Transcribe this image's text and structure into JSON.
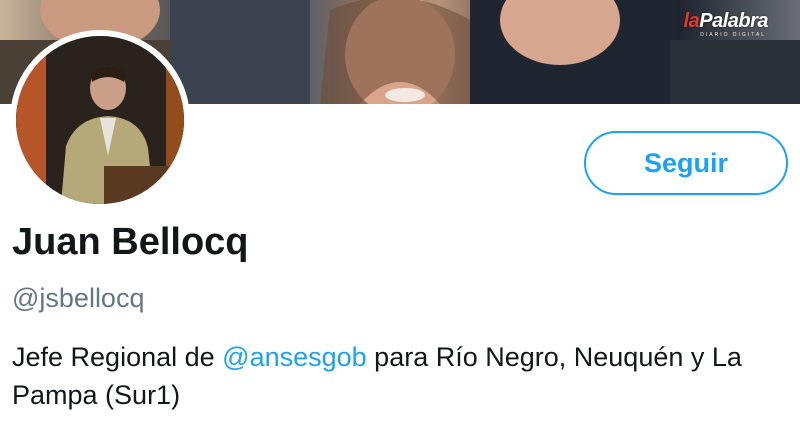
{
  "banner": {
    "logo_prefix": "la",
    "logo_main": "Palabra",
    "logo_tagline": "DIARIO DIGITAL"
  },
  "profile": {
    "name": "Juan Bellocq",
    "handle": "@jsbellocq",
    "follow_label": "Seguir",
    "bio_before": "Jefe Regional de ",
    "bio_mention": "@ansesgob",
    "bio_after": " para Río Negro, Neuquén y La Pampa (Sur1)"
  },
  "colors": {
    "accent": "#1da1f2",
    "text_primary": "#14171a",
    "text_secondary": "#657786"
  },
  "icons": {
    "avatar": "profile-photo",
    "banner": "header-photo"
  }
}
